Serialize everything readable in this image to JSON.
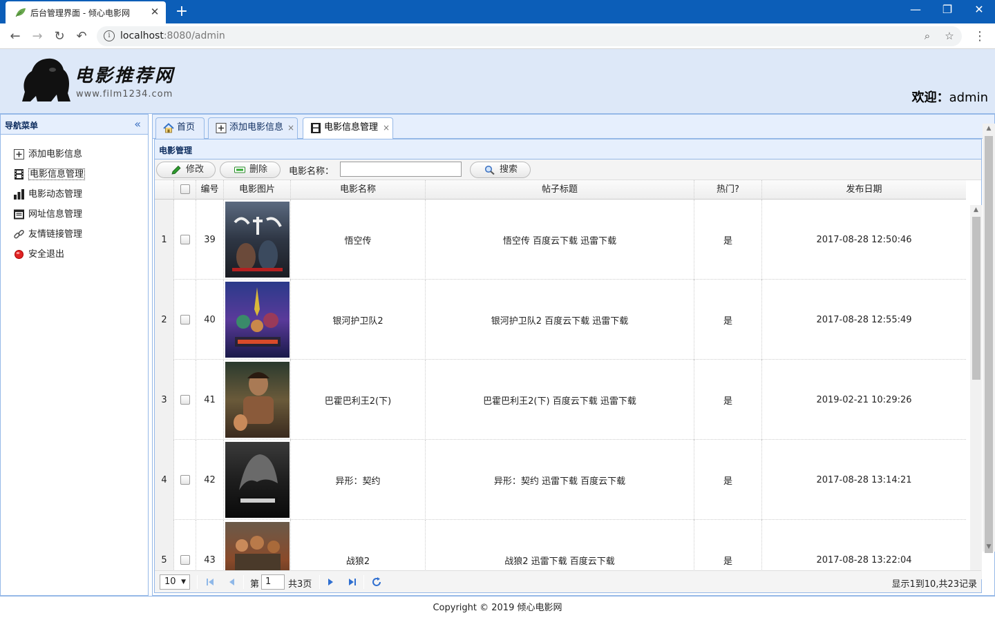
{
  "browser": {
    "tab_title": "后台管理界面 - 倾心电影网",
    "url_host": "localhost",
    "url_port_path": ":8080/admin"
  },
  "header": {
    "logo_title": "电影推荐网",
    "logo_url": "www.film1234.com",
    "welcome_label": "欢迎：",
    "username": "admin"
  },
  "nav": {
    "title": "导航菜单",
    "items": [
      {
        "label": "添加电影信息",
        "icon": "add-icon"
      },
      {
        "label": "电影信息管理",
        "icon": "film-icon"
      },
      {
        "label": "电影动态管理",
        "icon": "chart-icon"
      },
      {
        "label": "网址信息管理",
        "icon": "window-icon"
      },
      {
        "label": "友情链接管理",
        "icon": "link-icon"
      },
      {
        "label": "安全退出",
        "icon": "exit-icon"
      }
    ]
  },
  "center_tabs": [
    {
      "label": "首页",
      "icon": "home-icon"
    },
    {
      "label": "添加电影信息",
      "icon": "add-icon"
    },
    {
      "label": "电影信息管理",
      "icon": "film-icon"
    }
  ],
  "panel": {
    "title": "电影管理",
    "edit_label": "修改",
    "delete_label": "删除",
    "search_label": "电影名称：",
    "search_value": "",
    "search_button": "搜索"
  },
  "grid": {
    "columns": [
      "编号",
      "电影图片",
      "电影名称",
      "帖子标题",
      "热门?",
      "发布日期"
    ],
    "rows": [
      {
        "n": "1",
        "id": "39",
        "name": "悟空传",
        "title": "悟空传 百度云下载 迅雷下载",
        "hot": "是",
        "date": "2017-08-28 12:50:46"
      },
      {
        "n": "2",
        "id": "40",
        "name": "银河护卫队2",
        "title": "银河护卫队2 百度云下载 迅雷下载",
        "hot": "是",
        "date": "2017-08-28 12:55:49"
      },
      {
        "n": "3",
        "id": "41",
        "name": "巴霍巴利王2(下)",
        "title": "巴霍巴利王2(下) 百度云下载 迅雷下载",
        "hot": "是",
        "date": "2019-02-21 10:29:26"
      },
      {
        "n": "4",
        "id": "42",
        "name": "异形：契约",
        "title": "异形：契约 迅雷下载 百度云下载",
        "hot": "是",
        "date": "2017-08-28 13:14:21"
      },
      {
        "n": "5",
        "id": "43",
        "name": "战狼2",
        "title": "战狼2 迅雷下载 百度云下载",
        "hot": "是",
        "date": "2017-08-28 13:22:04"
      }
    ]
  },
  "pager": {
    "page_size": "10",
    "page_label": "第",
    "page_value": "1",
    "total_pages": "共3页",
    "info": "显示1到10,共23记录"
  },
  "footer": {
    "copyright": "Copyright © 2019 倾心电影网"
  },
  "colors": {
    "chrome_blue": "#0c5eb8",
    "panel_header": "#e6effd",
    "border": "#95b8e7"
  }
}
